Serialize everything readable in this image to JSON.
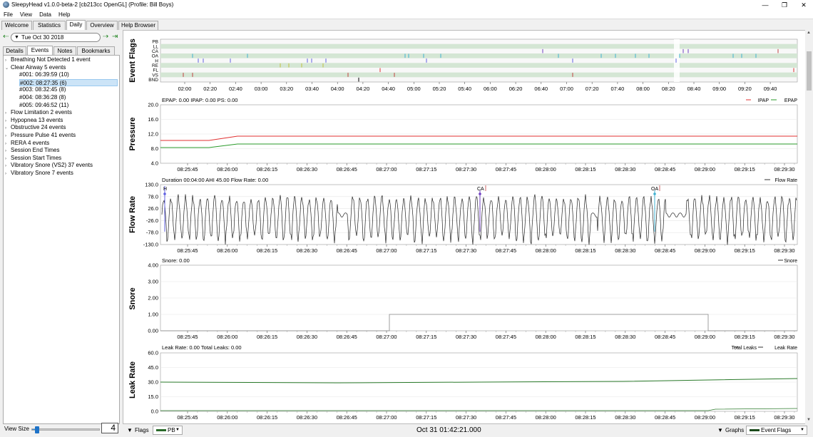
{
  "window": {
    "title": "SleepyHead v1.0.0-beta-2 [cb213cc OpenGL] (Profile:  Bill Boys)",
    "min": "—",
    "max": "❐",
    "close": "✕"
  },
  "menu": [
    "File",
    "View",
    "Data",
    "Help"
  ],
  "main_tabs": [
    "Welcome",
    "Statistics",
    "Daily",
    "Overview",
    "Help Browser"
  ],
  "active_main_tab": "Daily",
  "date_nav": {
    "back": "⇠",
    "date": "Tue Oct 30 2018",
    "forward": "⇢",
    "latest": "⇥"
  },
  "sub_tabs": [
    "Details",
    "Events",
    "Notes",
    "Bookmarks"
  ],
  "active_sub_tab": "Events",
  "events_tree": [
    {
      "label": "Breathing Not Detected 1 event",
      "level": 0,
      "expanded": false
    },
    {
      "label": "Clear Airway 5 events",
      "level": 0,
      "expanded": true
    },
    {
      "label": "#001: 06:39:59 (10)",
      "level": 1
    },
    {
      "label": "#002: 08:27:35 (6)",
      "level": 1,
      "selected": true
    },
    {
      "label": "#003: 08:32:45 (8)",
      "level": 1
    },
    {
      "label": "#004: 08:36:28 (8)",
      "level": 1
    },
    {
      "label": "#005: 09:46:52 (11)",
      "level": 1
    },
    {
      "label": "Flow Limitation 2 events",
      "level": 0,
      "expanded": false
    },
    {
      "label": "Hypopnea 13 events",
      "level": 0,
      "expanded": false
    },
    {
      "label": "Obstructive 24 events",
      "level": 0,
      "expanded": false
    },
    {
      "label": "Pressure Pulse 41 events",
      "level": 0,
      "expanded": false
    },
    {
      "label": "RERA 4 events",
      "level": 0,
      "expanded": false
    },
    {
      "label": "Session End Times",
      "level": 0,
      "expanded": false
    },
    {
      "label": "Session Start Times",
      "level": 0,
      "expanded": false
    },
    {
      "label": "Vibratory Snore (VS2)  37 events",
      "level": 0,
      "expanded": false
    },
    {
      "label": "Vibratory Snore 7 events",
      "level": 0,
      "expanded": false
    }
  ],
  "view_size": {
    "label": "View Size",
    "value": "4",
    "fraction": 0.05
  },
  "graphs": {
    "event_flags": {
      "title": "Event Flags",
      "rows": [
        "PB",
        "LL",
        "CA",
        "OA",
        "H",
        "RE",
        "FL",
        "VS",
        "BND"
      ],
      "time_ticks": [
        "02:00",
        "02:20",
        "02:40",
        "03:00",
        "03:20",
        "03:40",
        "04:00",
        "04:20",
        "04:40",
        "05:00",
        "05:20",
        "05:40",
        "06:00",
        "06:20",
        "06:40",
        "07:00",
        "07:20",
        "07:40",
        "08:00",
        "08:20",
        "08:40",
        "09:00",
        "09:20",
        "09:40"
      ]
    },
    "pressure": {
      "title": "Pressure",
      "info": "EPAP: 0.00 IPAP: 0.00 PS: 0.00",
      "legend": [
        "IPAP",
        "EPAP"
      ],
      "y_ticks": [
        "20.0",
        "16.0",
        "12.0",
        "8.0",
        "4.0"
      ]
    },
    "flow_rate": {
      "title": "Flow Rate",
      "info": "Duration 00:04:00 AHI 45.00 Flow Rate: 0.00",
      "legend": [
        "Flow Rate"
      ],
      "y_ticks": [
        "130.0",
        "78.0",
        "26.0",
        "-26.0",
        "-78.0",
        "-130.0"
      ],
      "markers": [
        "H",
        "CA",
        "OA"
      ]
    },
    "snore": {
      "title": "Snore",
      "info": "Snore: 0.00",
      "legend": [
        "Snore"
      ],
      "y_ticks": [
        "4.00",
        "3.00",
        "2.00",
        "1.00",
        "0.00"
      ]
    },
    "leak_rate": {
      "title": "Leak Rate",
      "info": "Leak Rate: 0.00 Total Leaks: 0.00",
      "legend": [
        "Total Leaks",
        "Leak Rate"
      ],
      "y_ticks": [
        "60.0",
        "45.0",
        "30.0",
        "15.0",
        "0.0"
      ]
    },
    "time_ticks_zoom": [
      "08:25:45",
      "08:26:00",
      "08:26:15",
      "08:26:30",
      "08:26:45",
      "08:27:00",
      "08:27:15",
      "08:27:30",
      "08:27:45",
      "08:28:00",
      "08:28:15",
      "08:28:30",
      "08:28:45",
      "08:29:00",
      "08:29:15",
      "08:29:30"
    ]
  },
  "colors": {
    "ipap": "#e03030",
    "epap": "#2a9a2a",
    "leak_total": "#2a7a2a",
    "ca": "#7040c0",
    "oa": "#40b0d0",
    "h": "#6060e0",
    "fl": "#e03030",
    "vs": "#c04040",
    "re": "#c0c040",
    "ll": "#904040",
    "band": "#d4e6d4",
    "highlight": "#ffffff"
  },
  "bottom": {
    "flags_label": "Flags",
    "flags_combo": "PB",
    "center_time": "Oct 31 01:42:21.000",
    "graphs_label": "Graphs",
    "graphs_combo": "Event Flags"
  }
}
